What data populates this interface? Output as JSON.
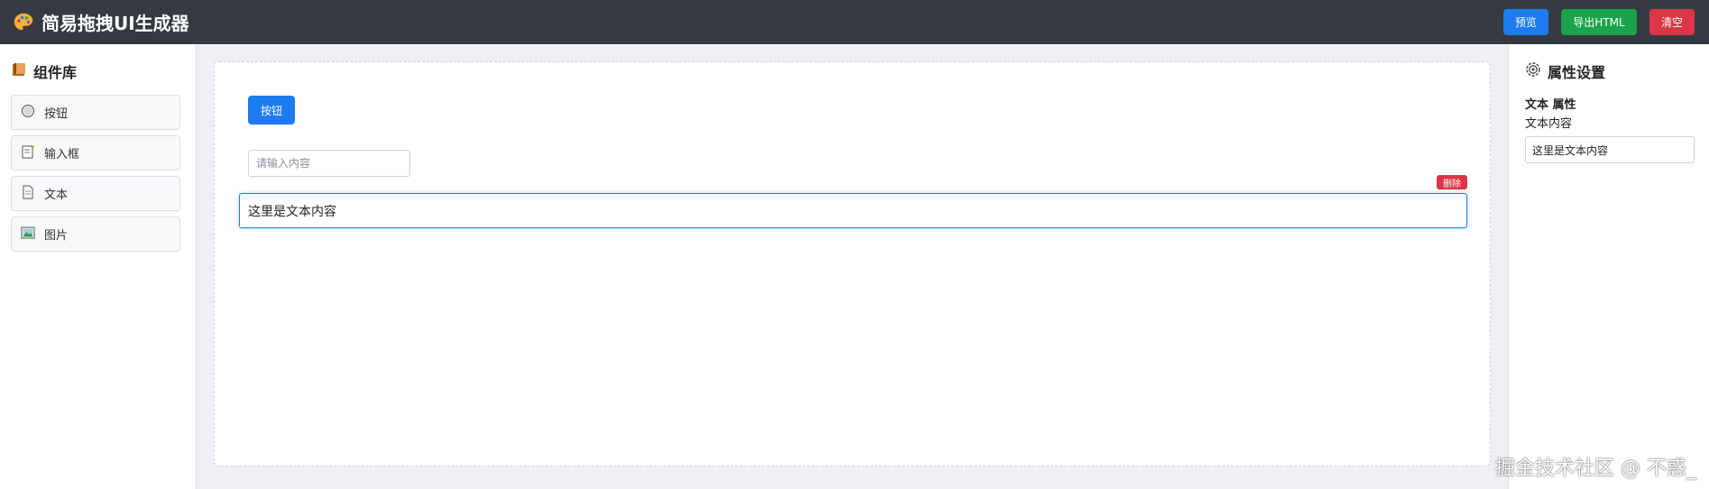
{
  "header": {
    "title": "简易拖拽UI生成器",
    "logo_icon": "palette-icon",
    "preview_label": "预览",
    "export_label": "导出HTML",
    "clear_label": "清空",
    "colors": {
      "background": "#343a40",
      "preview": "#1e7cf2",
      "export": "#1aa34a",
      "clear": "#dc3545"
    }
  },
  "left_panel": {
    "title": "组件库",
    "title_icon": "books-icon",
    "items": [
      {
        "label": "按钮",
        "icon": "radio-button-icon"
      },
      {
        "label": "输入框",
        "icon": "memo-icon"
      },
      {
        "label": "文本",
        "icon": "document-icon"
      },
      {
        "label": "图片",
        "icon": "picture-icon"
      }
    ]
  },
  "canvas": {
    "button_label": "按钮",
    "input_placeholder": "请输入内容",
    "text_content": "这里是文本内容",
    "delete_label": "删除"
  },
  "right_panel": {
    "title": "属性设置",
    "title_icon": "gear-icon",
    "section_title": "文本 属性",
    "field_label": "文本内容",
    "field_value": "这里是文本内容"
  },
  "watermark": "掘金技术社区 @ 不惑_"
}
